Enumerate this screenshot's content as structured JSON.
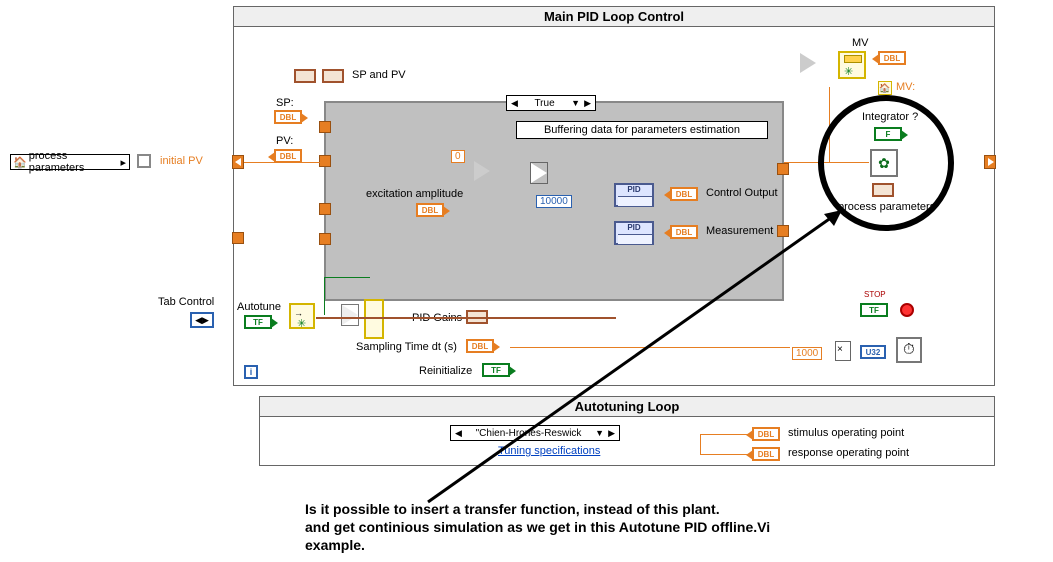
{
  "main_loop": {
    "title": "Main PID Loop Control",
    "case_selector": "True",
    "banner": "Buffering data for parameters estimation",
    "inputs": {
      "process_parameters": "process parameters",
      "initial_pv": "initial PV",
      "tab_control": "Tab Control"
    },
    "signals": {
      "sp": "SP:",
      "pv": "PV:",
      "sp_and_pv": "SP and PV",
      "excitation_amplitude": "excitation amplitude",
      "zero_const": "0",
      "buffer_size": "10000",
      "control_output": "Control Output",
      "measurement": "Measurement",
      "mv": "MV",
      "mv_local": "MV:",
      "integrator_q": "Integrator ?",
      "process_parameters_out": "process parameters",
      "pid_gains": "PID Gains",
      "sampling_time": "Sampling Time dt (s)",
      "reinitialize": "Reinitialize",
      "autotune": "Autotune",
      "one_thousand": "1000",
      "stop": "STOP"
    },
    "icons": {
      "dbl": "DBL",
      "tf": "TF",
      "pid": "PID",
      "u32": "U32",
      "loop_i": "i"
    }
  },
  "autotune_loop": {
    "title": "Autotuning Loop",
    "method_selector": "\"Chien-Hrones-Reswick",
    "tuning_spec": "Tuning specifications",
    "stimulus_op": "stimulus operating point",
    "response_op": "response operating point"
  },
  "annotation": {
    "line1": "Is it possible to insert a transfer function, instead of this plant.",
    "line2": "and get continious simulation as we get in this Autotune PID offline.Vi",
    "line3": "example."
  }
}
